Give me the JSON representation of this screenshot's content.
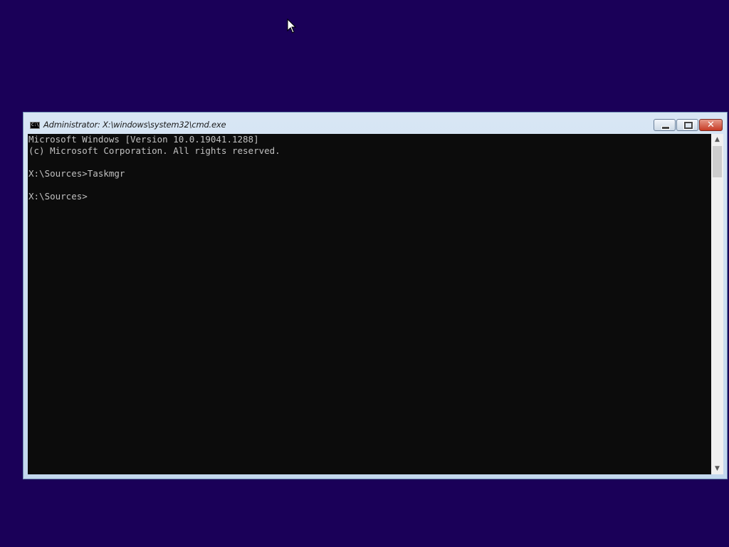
{
  "window": {
    "title": "Administrator: X:\\windows\\system32\\cmd.exe",
    "icon_label": "C:\\",
    "minimize_icon": "minimize-icon",
    "maximize_icon": "restore-icon",
    "close_label": "✕"
  },
  "console": {
    "lines": [
      "Microsoft Windows [Version 10.0.19041.1288]",
      "(c) Microsoft Corporation. All rights reserved.",
      "",
      "X:\\Sources>Taskmgr",
      "",
      "X:\\Sources>"
    ]
  },
  "scrollbar": {
    "up_arrow": "▲",
    "down_arrow": "▼"
  },
  "colors": {
    "desktop": "#1a0058",
    "console_bg": "#0c0c0c",
    "console_text": "#c0c0c0"
  }
}
